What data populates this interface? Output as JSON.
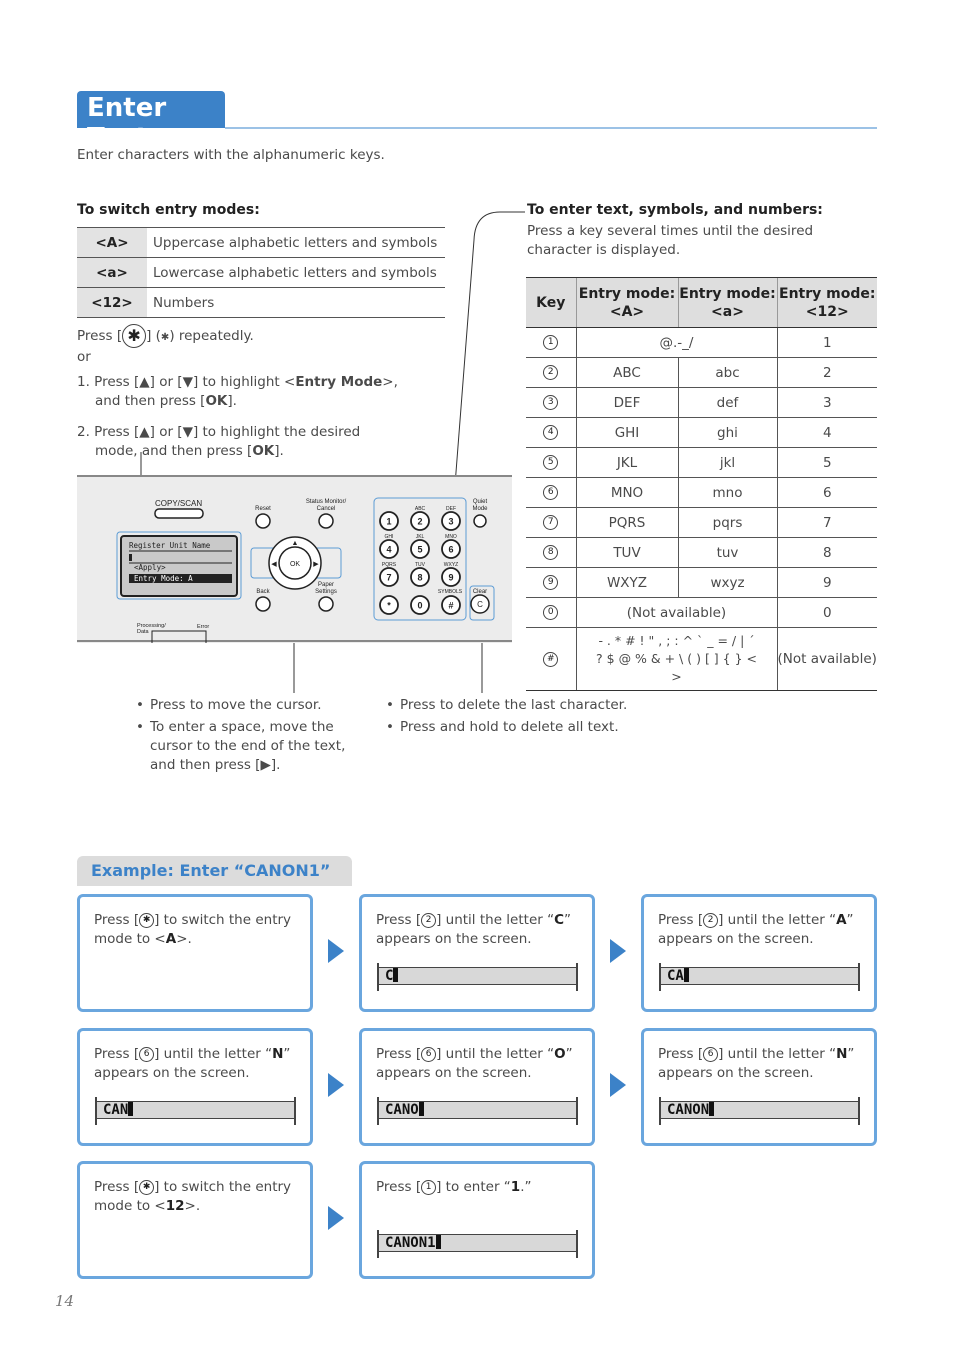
{
  "title": "Enter Text",
  "intro": "Enter characters with the alphanumeric keys.",
  "switch": {
    "heading": "To switch entry modes:",
    "modes": [
      {
        "key": "<A>",
        "desc": "Uppercase alphabetic letters and symbols"
      },
      {
        "key": "<a>",
        "desc": "Lowercase alphabetic letters and symbols"
      },
      {
        "key": "<12>",
        "desc": "Numbers"
      }
    ],
    "press_pre": "Press [",
    "press_post": "] (",
    "press_end": ") repeatedly.",
    "or": "or",
    "step1_a": "1.  Press [▲] or [▼] to highlight <",
    "step1_b": "Entry Mode",
    "step1_c": ">,",
    "step1_d": "and then press [",
    "step1_ok": "OK",
    "step1_e": "].",
    "step2_a": "2.  Press [▲] or [▼] to highlight the desired",
    "step2_b": "mode, and then press [",
    "step2_ok": "OK",
    "step2_c": "]."
  },
  "enter": {
    "heading": "To enter text, symbols, and numbers:",
    "desc": "Press a key several times until the desired character is displayed.",
    "headers": [
      "Key",
      "Entry mode: <A>",
      "Entry mode: <a>",
      "Entry mode: <12>"
    ],
    "rows": [
      {
        "key": "1",
        "A": "@.-_/",
        "a": null,
        "n": "1"
      },
      {
        "key": "2",
        "A": "ABC",
        "a": "abc",
        "n": "2"
      },
      {
        "key": "3",
        "A": "DEF",
        "a": "def",
        "n": "3"
      },
      {
        "key": "4",
        "A": "GHI",
        "a": "ghi",
        "n": "4"
      },
      {
        "key": "5",
        "A": "JKL",
        "a": "jkl",
        "n": "5"
      },
      {
        "key": "6",
        "A": "MNO",
        "a": "mno",
        "n": "6"
      },
      {
        "key": "7",
        "A": "PQRS",
        "a": "pqrs",
        "n": "7"
      },
      {
        "key": "8",
        "A": "TUV",
        "a": "tuv",
        "n": "8"
      },
      {
        "key": "9",
        "A": "WXYZ",
        "a": "wxyz",
        "n": "9"
      },
      {
        "key": "0",
        "A": "(Not available)",
        "a": null,
        "n": "0"
      },
      {
        "key": "#",
        "A": "- . * # ! \" , ; : ^ ` _ = / | ´ ? $ @ % & + \\ ( ) [ ] { } < >",
        "a": null,
        "n": "(Not available)"
      }
    ]
  },
  "panel": {
    "copy_scan": "COPY/SCAN",
    "reset": "Reset",
    "status": "Status Monitor/",
    "cancel": "Cancel",
    "back": "Back",
    "paper": "Paper",
    "settings": "Settings",
    "ok": "OK",
    "quiet": "Quiet",
    "mode": "Mode",
    "clear": "Clear",
    "clear_key": "C",
    "symbols": "SYMBOLS",
    "processing": "Processing/",
    "data": "Data",
    "error": "Error",
    "lcd": [
      "Register Unit Name",
      "<Apply>",
      "Entry Mode: A"
    ],
    "keys": [
      [
        "1",
        ""
      ],
      [
        "2",
        "ABC"
      ],
      [
        "3",
        "DEF"
      ],
      [
        "4",
        "GHI"
      ],
      [
        "5",
        "JKL"
      ],
      [
        "6",
        "MNO"
      ],
      [
        "7",
        "PQRS"
      ],
      [
        "8",
        "TUV"
      ],
      [
        "9",
        "WXYZ"
      ],
      [
        "*",
        ""
      ],
      [
        "0",
        ""
      ],
      [
        "#",
        ""
      ]
    ]
  },
  "notes_left": [
    "Press to move the cursor.",
    "To enter a space, move the cursor to the end of the text, and then press [▶]."
  ],
  "notes_right": [
    "Press to delete the last character.",
    "Press and hold to delete all text."
  ],
  "example": {
    "heading": "Example: Enter “CANON1”",
    "steps": [
      {
        "a": "Press [",
        "k": "*",
        "b": "] to switch the entry mode to <",
        "bold": "A",
        "c": ">.",
        "lcd": null
      },
      {
        "a": "Press [",
        "k": "2",
        "b": "] until the letter “",
        "bold": "C",
        "c": "” appears on the screen.",
        "lcd": "C"
      },
      {
        "a": "Press [",
        "k": "2",
        "b": "] until the letter “",
        "bold": "A",
        "c": "” appears on the screen.",
        "lcd": "CA"
      },
      {
        "a": "Press [",
        "k": "6",
        "b": "] until the letter “",
        "bold": "N",
        "c": "” appears on the screen.",
        "lcd": "CAN"
      },
      {
        "a": "Press [",
        "k": "6",
        "b": "] until the letter “",
        "bold": "O",
        "c": "” appears on the screen.",
        "lcd": "CANO"
      },
      {
        "a": "Press [",
        "k": "6",
        "b": "] until the letter “",
        "bold": "N",
        "c": "” appears on the screen.",
        "lcd": "CANON"
      },
      {
        "a": "Press [",
        "k": "*",
        "b": "] to switch the entry mode to <",
        "bold": "12",
        "c": ">.",
        "lcd": null
      },
      {
        "a": "Press [",
        "k": "1",
        "b": "] to enter “",
        "bold": "1",
        "c": ".”",
        "lcd": "CANON1"
      }
    ]
  },
  "page_number": "14",
  "colors": {
    "accent": "#3c82c8",
    "box_border": "#6aa6de"
  }
}
